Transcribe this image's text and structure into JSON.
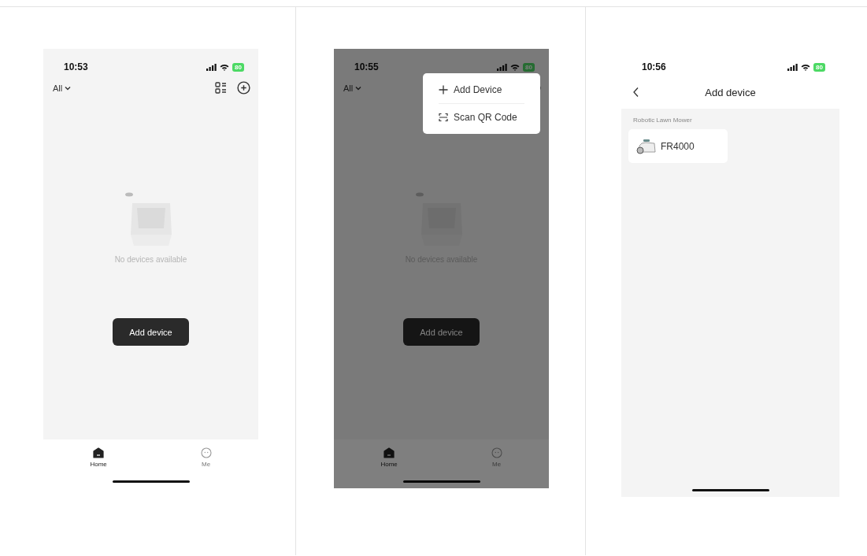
{
  "screens": [
    {
      "kind": "home",
      "status": {
        "time": "10:53",
        "battery": "80"
      },
      "filter": "All",
      "empty_text": "No devices available",
      "add_button": "Add device",
      "tabs": [
        {
          "label": "Home",
          "kind": "home",
          "selected": true
        },
        {
          "label": "Me",
          "kind": "me",
          "selected": false
        }
      ],
      "dimmed": false
    },
    {
      "kind": "home",
      "status": {
        "time": "10:55",
        "battery": "80"
      },
      "filter": "All",
      "empty_text": "No devices available",
      "add_button": "Add device",
      "tabs": [
        {
          "label": "Home",
          "kind": "home",
          "selected": true
        },
        {
          "label": "Me",
          "kind": "me",
          "selected": false
        }
      ],
      "dimmed": true,
      "menu": [
        {
          "label": "Add Device",
          "kind": "add"
        },
        {
          "label": "Scan QR Code",
          "kind": "scan"
        }
      ]
    },
    {
      "kind": "add_device",
      "status": {
        "time": "10:56",
        "battery": "80"
      },
      "title": "Add device",
      "category": "Robotic Lawn Mower",
      "devices": [
        {
          "name": "FR4000"
        }
      ]
    }
  ]
}
